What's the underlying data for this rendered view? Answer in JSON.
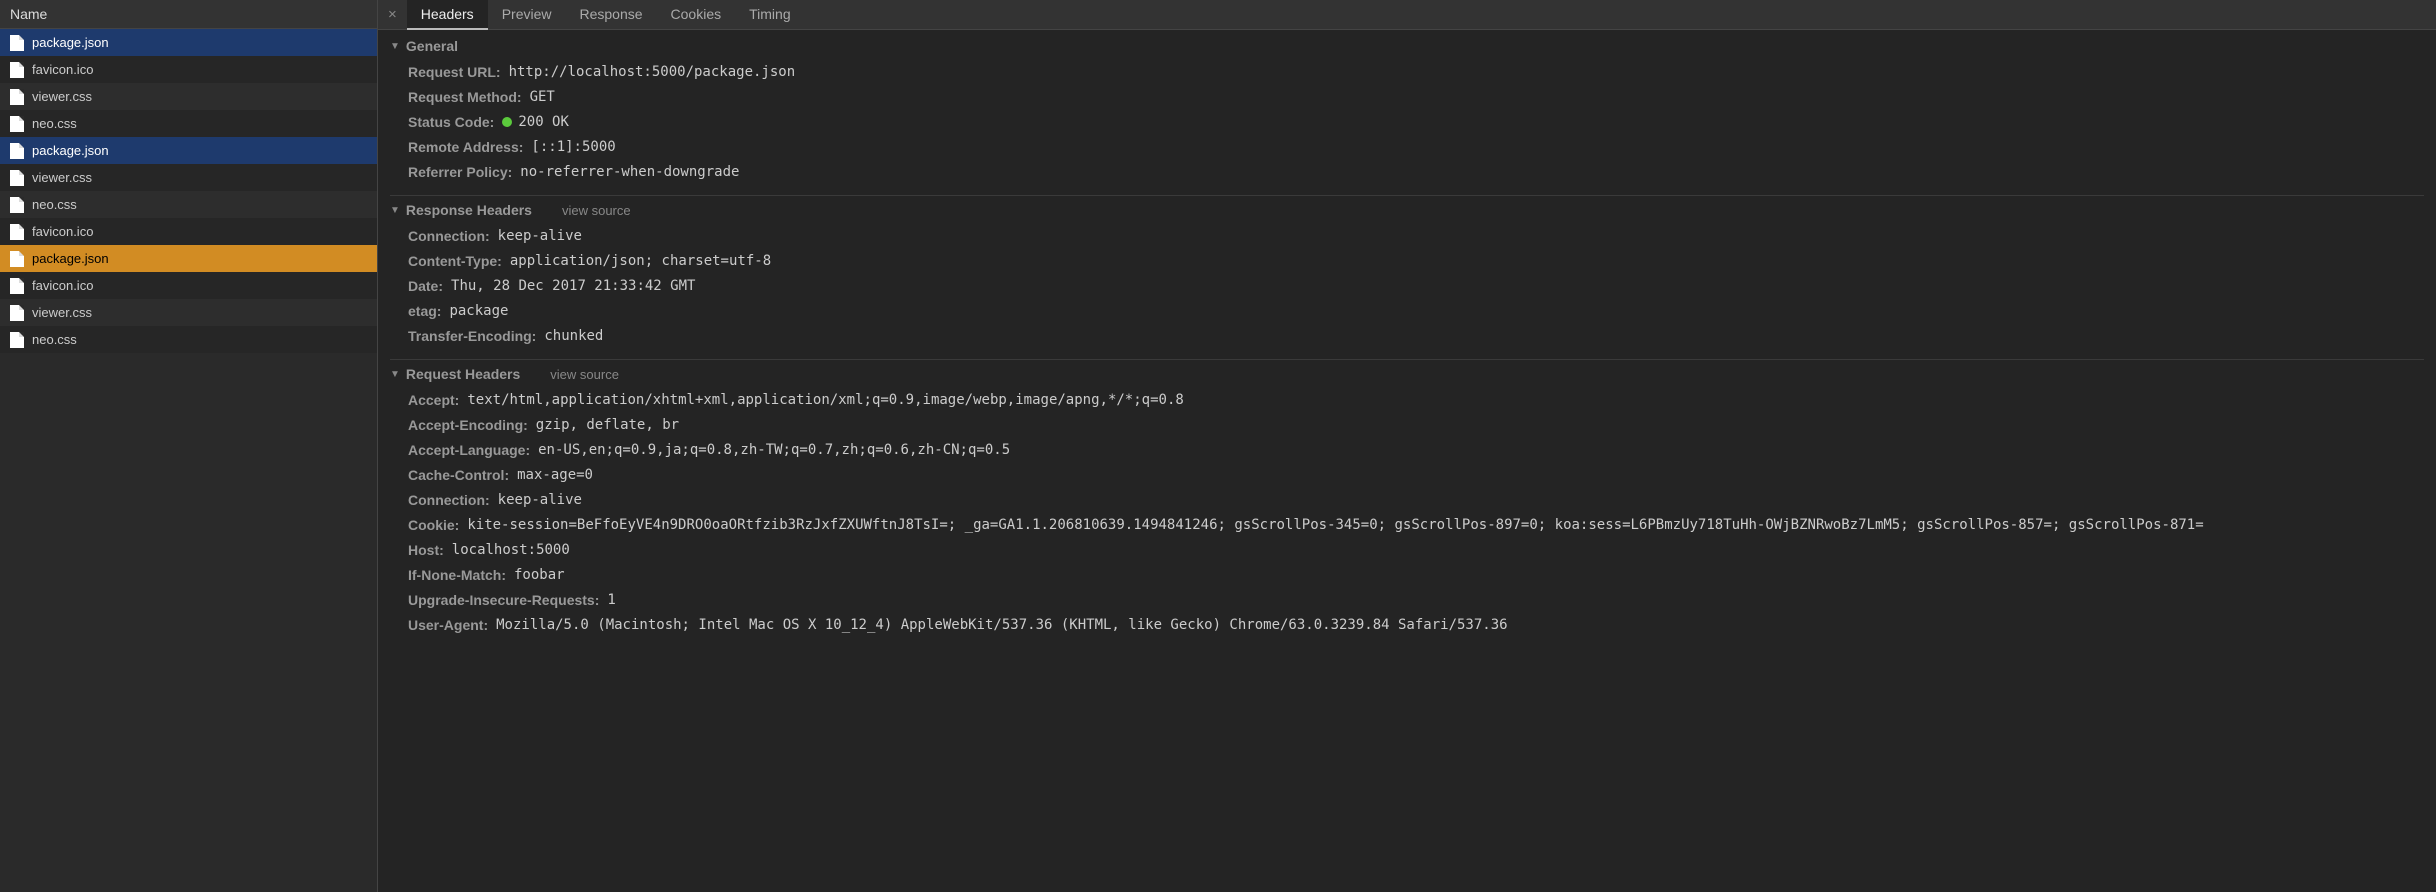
{
  "sidebar": {
    "header": "Name",
    "files": [
      {
        "name": "package.json",
        "state": "selected-blue"
      },
      {
        "name": "favicon.ico",
        "state": ""
      },
      {
        "name": "viewer.css",
        "state": ""
      },
      {
        "name": "neo.css",
        "state": ""
      },
      {
        "name": "package.json",
        "state": "selected-blue"
      },
      {
        "name": "viewer.css",
        "state": ""
      },
      {
        "name": "neo.css",
        "state": ""
      },
      {
        "name": "favicon.ico",
        "state": ""
      },
      {
        "name": "package.json",
        "state": "selected-orange"
      },
      {
        "name": "favicon.ico",
        "state": ""
      },
      {
        "name": "viewer.css",
        "state": ""
      },
      {
        "name": "neo.css",
        "state": ""
      }
    ]
  },
  "tabs": {
    "close": "×",
    "items": [
      {
        "label": "Headers",
        "active": true
      },
      {
        "label": "Preview",
        "active": false
      },
      {
        "label": "Response",
        "active": false
      },
      {
        "label": "Cookies",
        "active": false
      },
      {
        "label": "Timing",
        "active": false
      }
    ]
  },
  "sections": {
    "general": {
      "title": "General",
      "rows": [
        {
          "k": "Request URL:",
          "v": "http://localhost:5000/package.json"
        },
        {
          "k": "Request Method:",
          "v": "GET"
        },
        {
          "k": "Status Code:",
          "v": "200 OK",
          "status": true
        },
        {
          "k": "Remote Address:",
          "v": "[::1]:5000"
        },
        {
          "k": "Referrer Policy:",
          "v": "no-referrer-when-downgrade"
        }
      ]
    },
    "response": {
      "title": "Response Headers",
      "viewSource": "view source",
      "rows": [
        {
          "k": "Connection:",
          "v": "keep-alive"
        },
        {
          "k": "Content-Type:",
          "v": "application/json; charset=utf-8"
        },
        {
          "k": "Date:",
          "v": "Thu, 28 Dec 2017 21:33:42 GMT"
        },
        {
          "k": "etag:",
          "v": "package"
        },
        {
          "k": "Transfer-Encoding:",
          "v": "chunked"
        }
      ]
    },
    "request": {
      "title": "Request Headers",
      "viewSource": "view source",
      "rows": [
        {
          "k": "Accept:",
          "v": "text/html,application/xhtml+xml,application/xml;q=0.9,image/webp,image/apng,*/*;q=0.8"
        },
        {
          "k": "Accept-Encoding:",
          "v": "gzip, deflate, br"
        },
        {
          "k": "Accept-Language:",
          "v": "en-US,en;q=0.9,ja;q=0.8,zh-TW;q=0.7,zh;q=0.6,zh-CN;q=0.5"
        },
        {
          "k": "Cache-Control:",
          "v": "max-age=0"
        },
        {
          "k": "Connection:",
          "v": "keep-alive"
        },
        {
          "k": "Cookie:",
          "v": "kite-session=BeFfoEyVE4n9DRO0oaORtfzib3RzJxfZXUWftnJ8TsI=; _ga=GA1.1.206810639.1494841246; gsScrollPos-345=0; gsScrollPos-897=0; koa:sess=L6PBmzUy718TuHh-OWjBZNRwoBz7LmM5; gsScrollPos-857=; gsScrollPos-871="
        },
        {
          "k": "Host:",
          "v": "localhost:5000"
        },
        {
          "k": "If-None-Match:",
          "v": "foobar"
        },
        {
          "k": "Upgrade-Insecure-Requests:",
          "v": "1"
        },
        {
          "k": "User-Agent:",
          "v": "Mozilla/5.0 (Macintosh; Intel Mac OS X 10_12_4) AppleWebKit/537.36 (KHTML, like Gecko) Chrome/63.0.3239.84 Safari/537.36"
        }
      ]
    }
  }
}
